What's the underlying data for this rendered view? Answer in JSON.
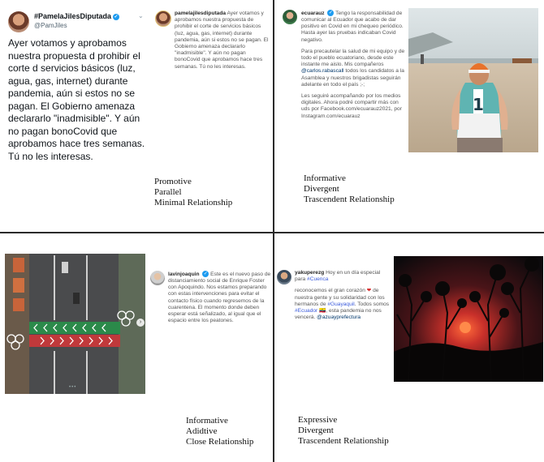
{
  "panel1": {
    "display_name": "#PamelaJilesDiputada",
    "handle": "@PamJiles",
    "tweet": "Ayer votamos y aprobamos nuestra propuesta d prohibir el corte d servicios básicos (luz, agua, gas, internet) durante pandemia, aún si estos no se pagan. El Gobierno amenaza declararlo \"inadmisible\". Y aún no pagan bonoCovid que aprobamos hace tres semanas. Tú no les interesas.",
    "ig_user": "pamelajilesdiputada",
    "ig_caption": "Ayer votamos y aprobamos nuestra propuesta de prohibir el corte de servicios básicos (luz, agua, gas, internet) durante pandemia, aún si estos no se pagan. El Gobierno amenaza declararlo \"inadmisible\". Y aún no pagan bonoCovid que aprobamos hace tres semanas. Tú no les interesas.",
    "labels": [
      "Promotive",
      "Parallel",
      "Minimal Relationship"
    ]
  },
  "panel2": {
    "ig_user": "ecuarauz",
    "para1": "Tengo la responsabilidad de comunicar al Ecuador que acabo de dar positivo en Covid en mi chequeo periódico. Hasta ayer las pruebas indicaban Covid negativo.",
    "para2_a": "Para precautelar la salud de mi equipo y de todo el pueblo ecuatoriano, desde este instante me aislo. Mis compañeros ",
    "para2_mention": "@carlos.rabascall",
    "para2_b": " todos los candidatos a la Asamblea y nuestros brigadistas seguirán adelante en todo el país ;-;",
    "para3": "Les seguiré acompañando por los medios digitales. Ahora podré compartir más con uds por Facebook.com/ecuarauz2021, por Instagram.com/ecuarauz",
    "jersey_number": "1",
    "labels": [
      "Informative",
      "Divergent",
      "Trascendent Relationship"
    ]
  },
  "panel3": {
    "ig_user": "lavinjoaquin",
    "caption": "Este es el nuevo paso de distanciamiento social de Enrique Foster con Apoquindo. Nos estamos preparando con estas intervenciones para evitar el contacto físico cuando regresemos de la cuarentena. El momento donde deben esperar está señalizado, al igual que el espacio entre los peatones.",
    "labels": [
      "Informative",
      "Adidtive",
      "Close Relationship"
    ]
  },
  "panel4": {
    "ig_user": "yakuperezg",
    "line1": "Hoy en un día especial para ",
    "hashtag1": "#Cuenca",
    "line2a": "reconocemos el gran corazón ",
    "line2b": " de nuestra gente y su solidaridad con los hermanos de ",
    "hashtag2": "#Guayaquil",
    "line2c": ". Todos somos ",
    "hashtag3": "#Ecuador",
    "line2d": " 🇪🇨, esta pandemia no nos vencerá. ",
    "mention": "@azuayprefectura",
    "labels": [
      "Expressive",
      "Divergent",
      "Trascendent Relationship"
    ]
  },
  "colors": {
    "verified": "#1d9bf0",
    "mention": "#00376b",
    "divider": "#2a2a2a"
  }
}
